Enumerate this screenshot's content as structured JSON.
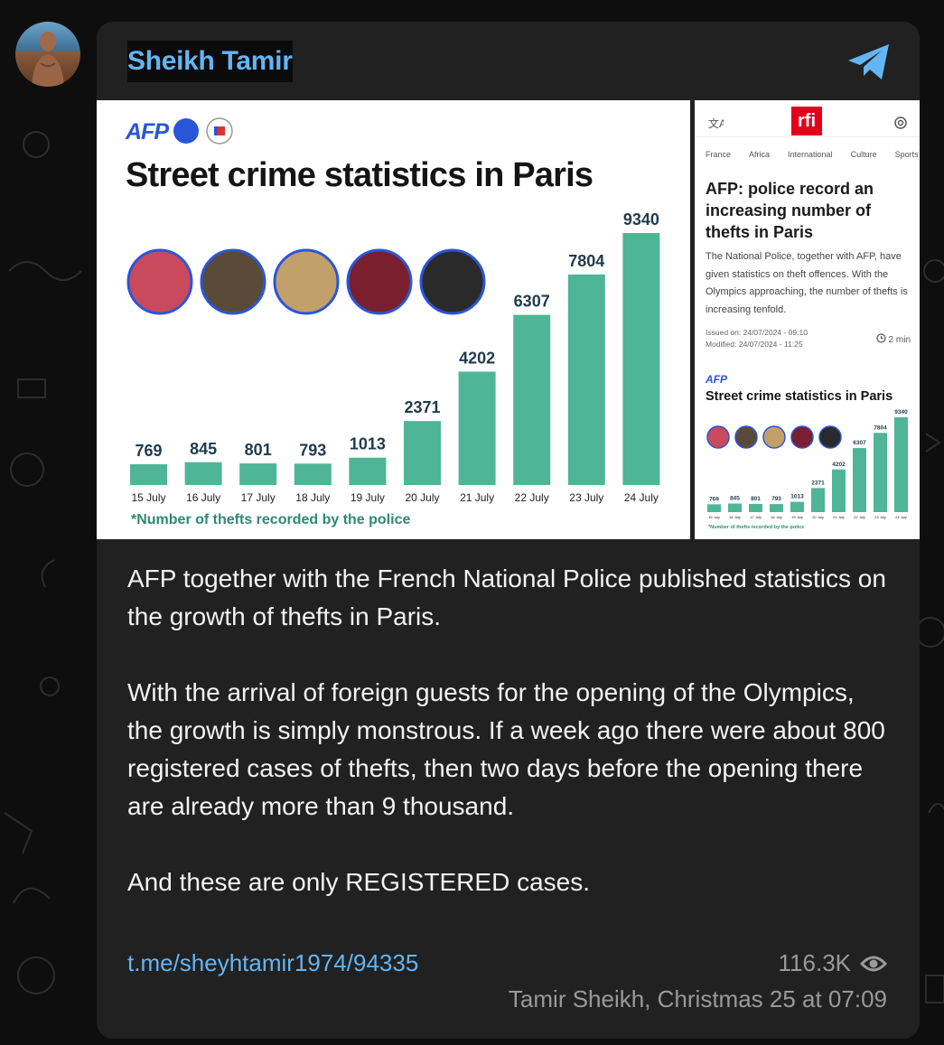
{
  "channel": {
    "name": "Sheikh Tamir"
  },
  "main_image": {
    "logo": "AFP",
    "title": "Street crime statistics in Paris",
    "footnote": "*Number of thefts recorded by the police"
  },
  "chart_data": {
    "type": "bar",
    "title": "Street crime statistics in Paris",
    "categories": [
      "15 July",
      "16 July",
      "17 July",
      "18 July",
      "19 July",
      "20 July",
      "21 July",
      "22 July",
      "23 July",
      "24 July"
    ],
    "values": [
      769,
      845,
      801,
      793,
      1013,
      2371,
      4202,
      6307,
      7804,
      9340
    ],
    "labels": [
      "769",
      "845",
      "801",
      "793",
      "1013",
      "2371",
      "4202",
      "6307",
      "7804",
      "9340"
    ],
    "bar_color": "#4fb597",
    "label_color": "#1f3b4d"
  },
  "side_image": {
    "brand": "rfi",
    "nav": [
      "France",
      "Africa",
      "International",
      "Culture",
      "Sports"
    ],
    "headline": "AFP: police record an increasing number of thefts in Paris",
    "body": "The National Police, together with AFP, have given statistics on theft offences. With the Olympics approaching, the number of thefts is increasing tenfold.",
    "issued": "Issued on: 24/07/2024 - 09:10",
    "modified": "Modified: 24/07/2024 - 11:25",
    "read_time": "2 min",
    "logo": "AFP",
    "chart_title": "Street crime statistics in Paris"
  },
  "post": {
    "paragraph1": "AFP together with the French National Police published statistics on the growth of thefts in Paris.",
    "paragraph2": "With the arrival of foreign guests for the opening of the Olympics, the growth is simply monstrous. If a week ago there were about 800 registered cases of thefts, then two days before the opening there are already more than 9 thousand.",
    "paragraph3": "And these are only REGISTERED cases.",
    "link": "t.me/sheyhtamir1974/94335",
    "views": "116.3K",
    "author_line": "Tamir Sheikh, Christmas 25 at 07:09"
  },
  "colors": {
    "accent": "#64b5f6",
    "card": "#212121",
    "background": "#0e0e0e"
  }
}
